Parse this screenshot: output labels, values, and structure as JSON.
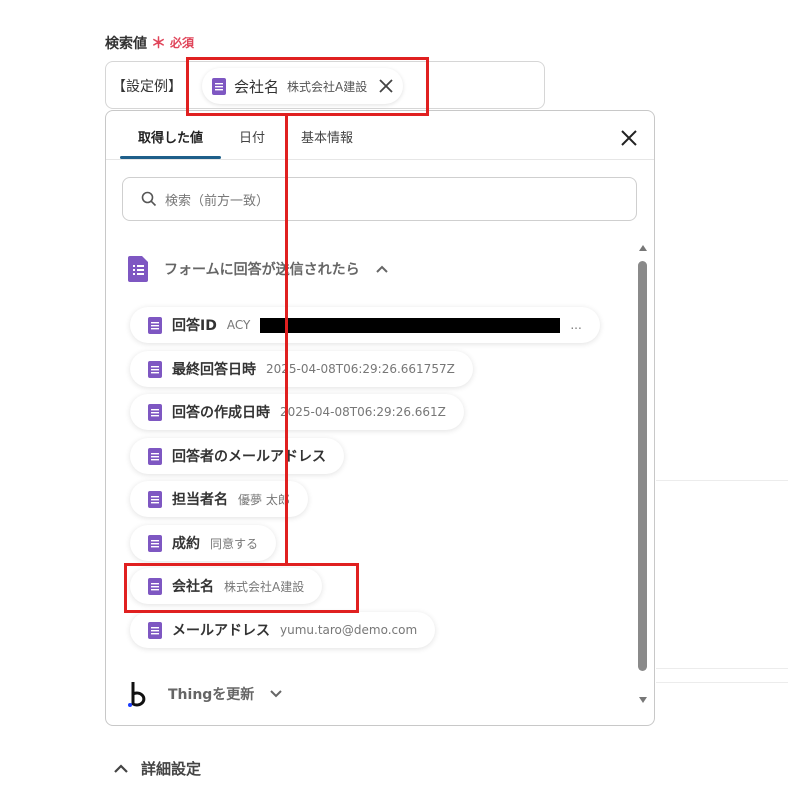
{
  "field": {
    "label": "検索値",
    "required_star": "＊",
    "required_text": "必須"
  },
  "input": {
    "prefix": "【設定例】",
    "chip_label": "会社名",
    "chip_value": "株式会社A建設"
  },
  "panel": {
    "tabs": [
      {
        "label": "取得した値",
        "active": true
      },
      {
        "label": "日付",
        "active": false
      },
      {
        "label": "基本情報",
        "active": false
      }
    ],
    "search_placeholder": "検索（前方一致）",
    "section_title": "フォームに回答が送信されたら",
    "items": [
      {
        "label": "回答ID",
        "value": "ACY",
        "tail": "..."
      },
      {
        "label": "最終回答日時",
        "value": "2025-04-08T06:29:26.661757Z"
      },
      {
        "label": "回答の作成日時",
        "value": "2025-04-08T06:29:26.661Z"
      },
      {
        "label": "回答者のメールアドレス",
        "value": ""
      },
      {
        "label": "担当者名",
        "value": "優夢 太郎"
      },
      {
        "label": "成約",
        "value": "同意する"
      },
      {
        "label": "会社名",
        "value": "株式会社A建設"
      },
      {
        "label": "メールアドレス",
        "value": "yumu.taro@demo.com"
      }
    ],
    "thing_label": "Thingを更新"
  },
  "detail": {
    "label": "詳細設定"
  },
  "colors": {
    "doc_icon": "#7e57c2",
    "highlight": "#e02020",
    "tab_underline": "#1e5f8a",
    "required": "#e0455a"
  }
}
